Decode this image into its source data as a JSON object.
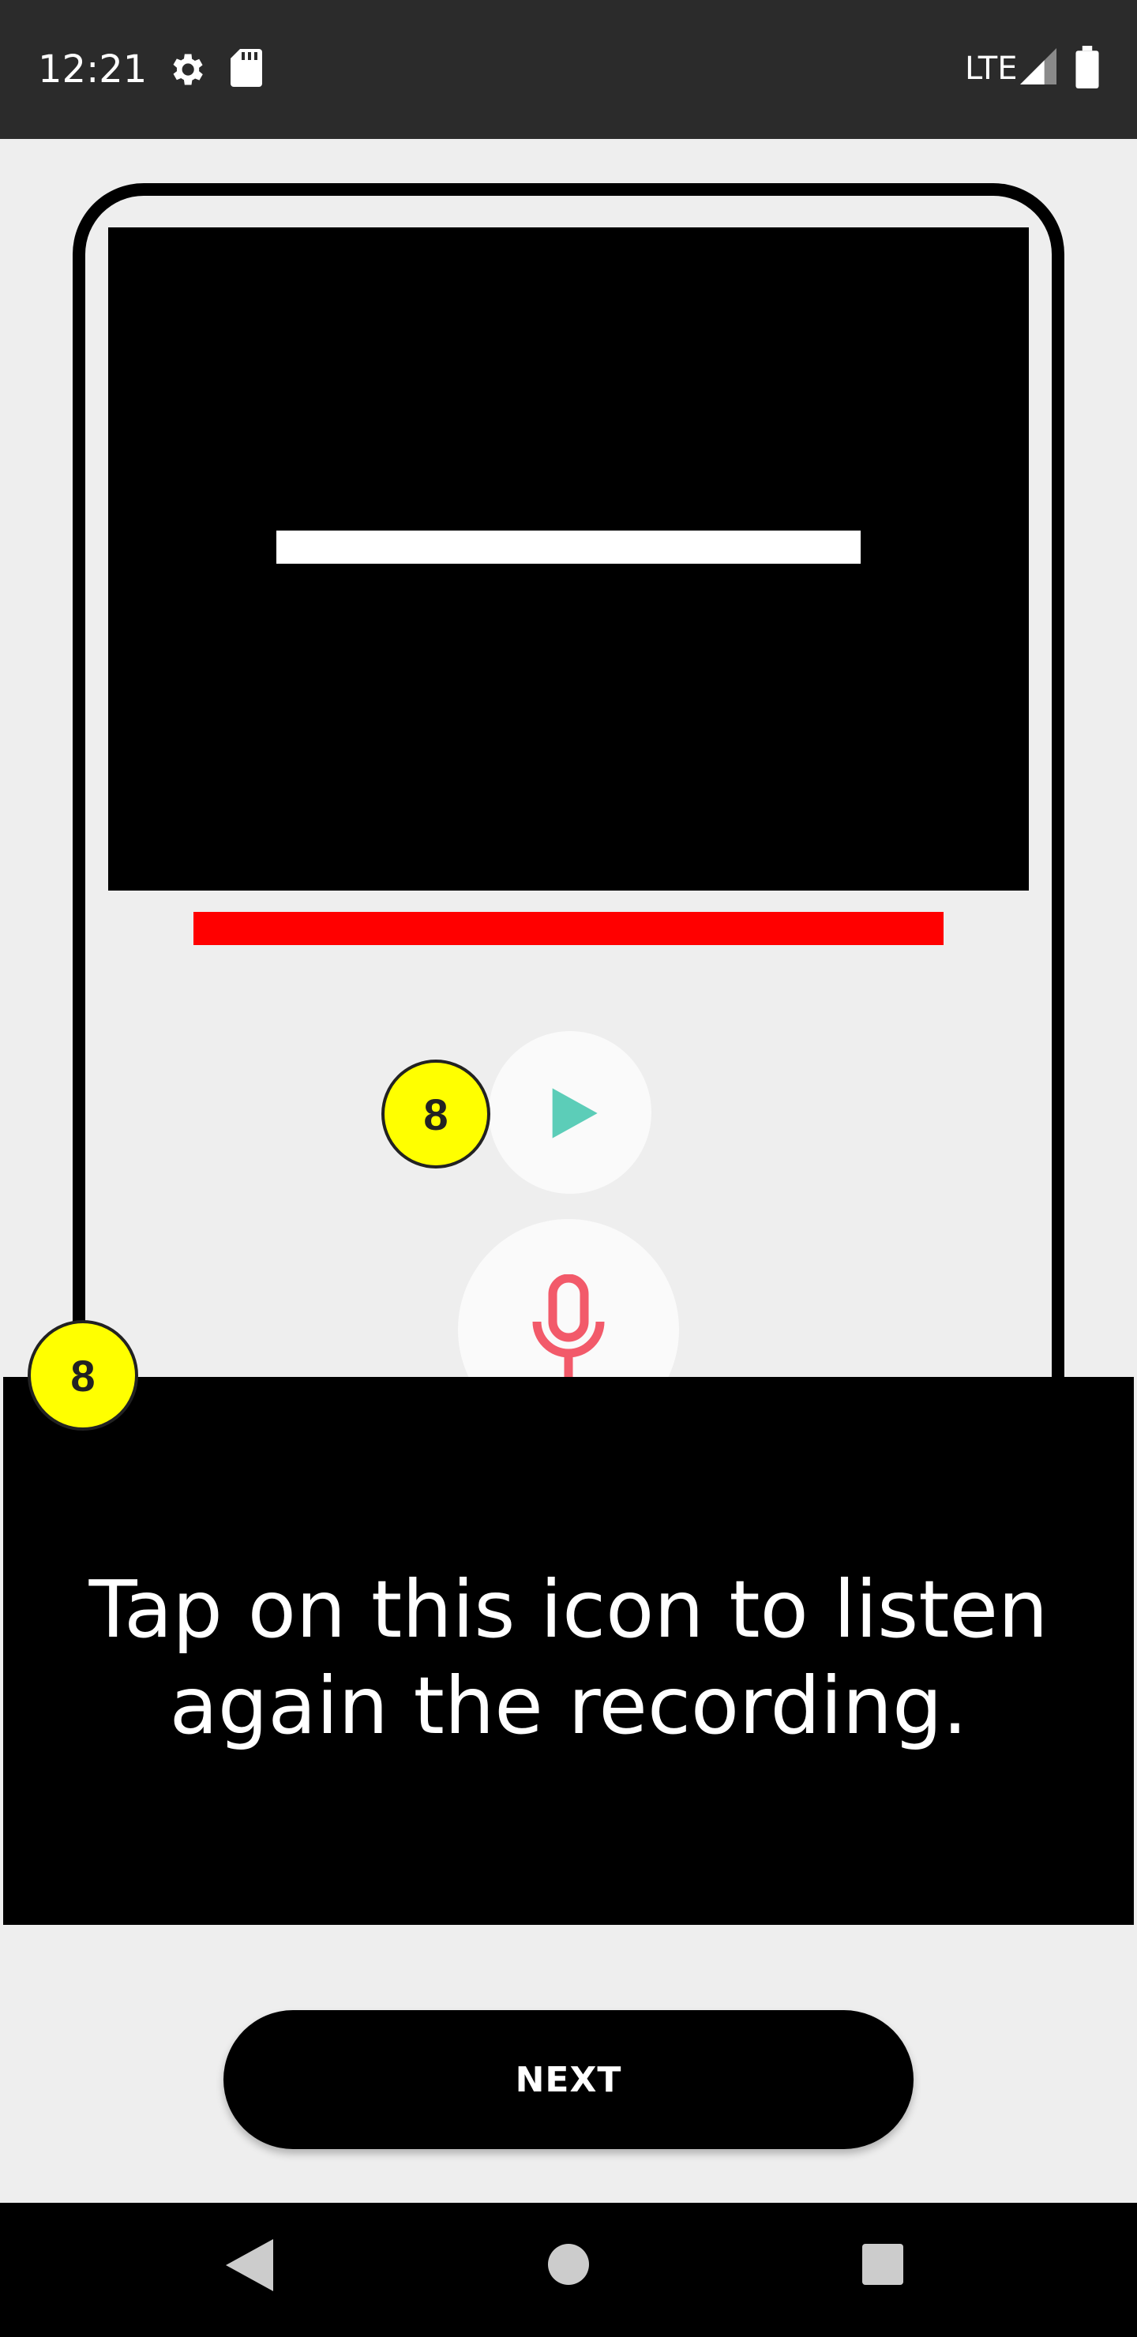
{
  "status_bar": {
    "time": "12:21",
    "network_label": "LTE",
    "icons": [
      "gear-icon",
      "sd-card-icon",
      "signal-icon",
      "battery-icon"
    ]
  },
  "tutorial": {
    "step_number": "8",
    "tooltip_text": "Tap on this icon to listen again the recording.",
    "next_label": "NEXT"
  },
  "illustration": {
    "play_icon": "play-icon",
    "mic_icon": "microphone-icon",
    "colors": {
      "play_accent": "#5ccdb8",
      "mic_accent": "#f25a6a",
      "progress_bar": "#ff0000",
      "badge": "#ffff00"
    }
  },
  "nav_bar": {
    "icons": [
      "back-icon",
      "home-icon",
      "recents-icon"
    ]
  }
}
